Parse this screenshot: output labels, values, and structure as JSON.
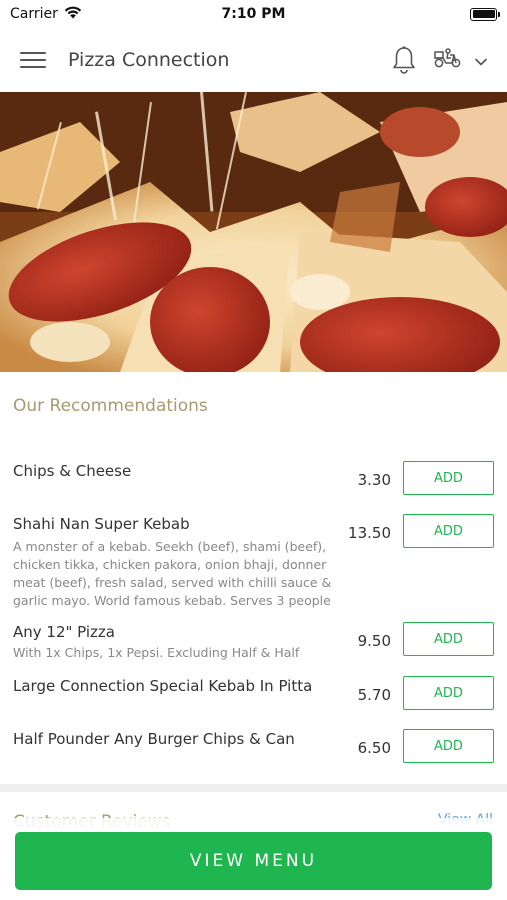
{
  "status_bar": {
    "carrier": "Carrier",
    "time": "7:10 PM"
  },
  "header": {
    "title": "Pizza Connection",
    "icons": [
      "menu-icon",
      "bell-icon",
      "scooter-icon",
      "chevron-down-icon"
    ]
  },
  "hero": {
    "image_subject": "pepperoni pizza with melted cheese"
  },
  "recommendations": {
    "title": "Our Recommendations",
    "items": [
      {
        "name": "Chips & Cheese",
        "description": "",
        "price": "3.30",
        "add_label": "ADD"
      },
      {
        "name": "Shahi Nan Super Kebab",
        "description": "A monster of a kebab. Seekh (beef), shami (beef), chicken tikka, chicken pakora, onion bhaji, donner meat (beef), fresh salad, served with chilli sauce & garlic mayo. World famous kebab. Serves 3 people",
        "price": "13.50",
        "add_label": "ADD"
      },
      {
        "name": "Any 12\" Pizza",
        "description": "With 1x Chips, 1x Pepsi. Excluding Half & Half",
        "price": "9.50",
        "add_label": "ADD"
      },
      {
        "name": "Large Connection Special Kebab In Pitta",
        "description": "",
        "price": "5.70",
        "add_label": "ADD"
      },
      {
        "name": "Half Pounder Any Burger Chips & Can",
        "description": "",
        "price": "6.50",
        "add_label": "ADD"
      }
    ]
  },
  "next_section": {
    "title": "Customer Reviews",
    "link": "View All"
  },
  "footer": {
    "view_menu_label": "VIEW MENU"
  },
  "colors": {
    "accent_green": "#1fb650",
    "section_title": "#a89a6e",
    "link_blue": "#6aa0d8"
  }
}
